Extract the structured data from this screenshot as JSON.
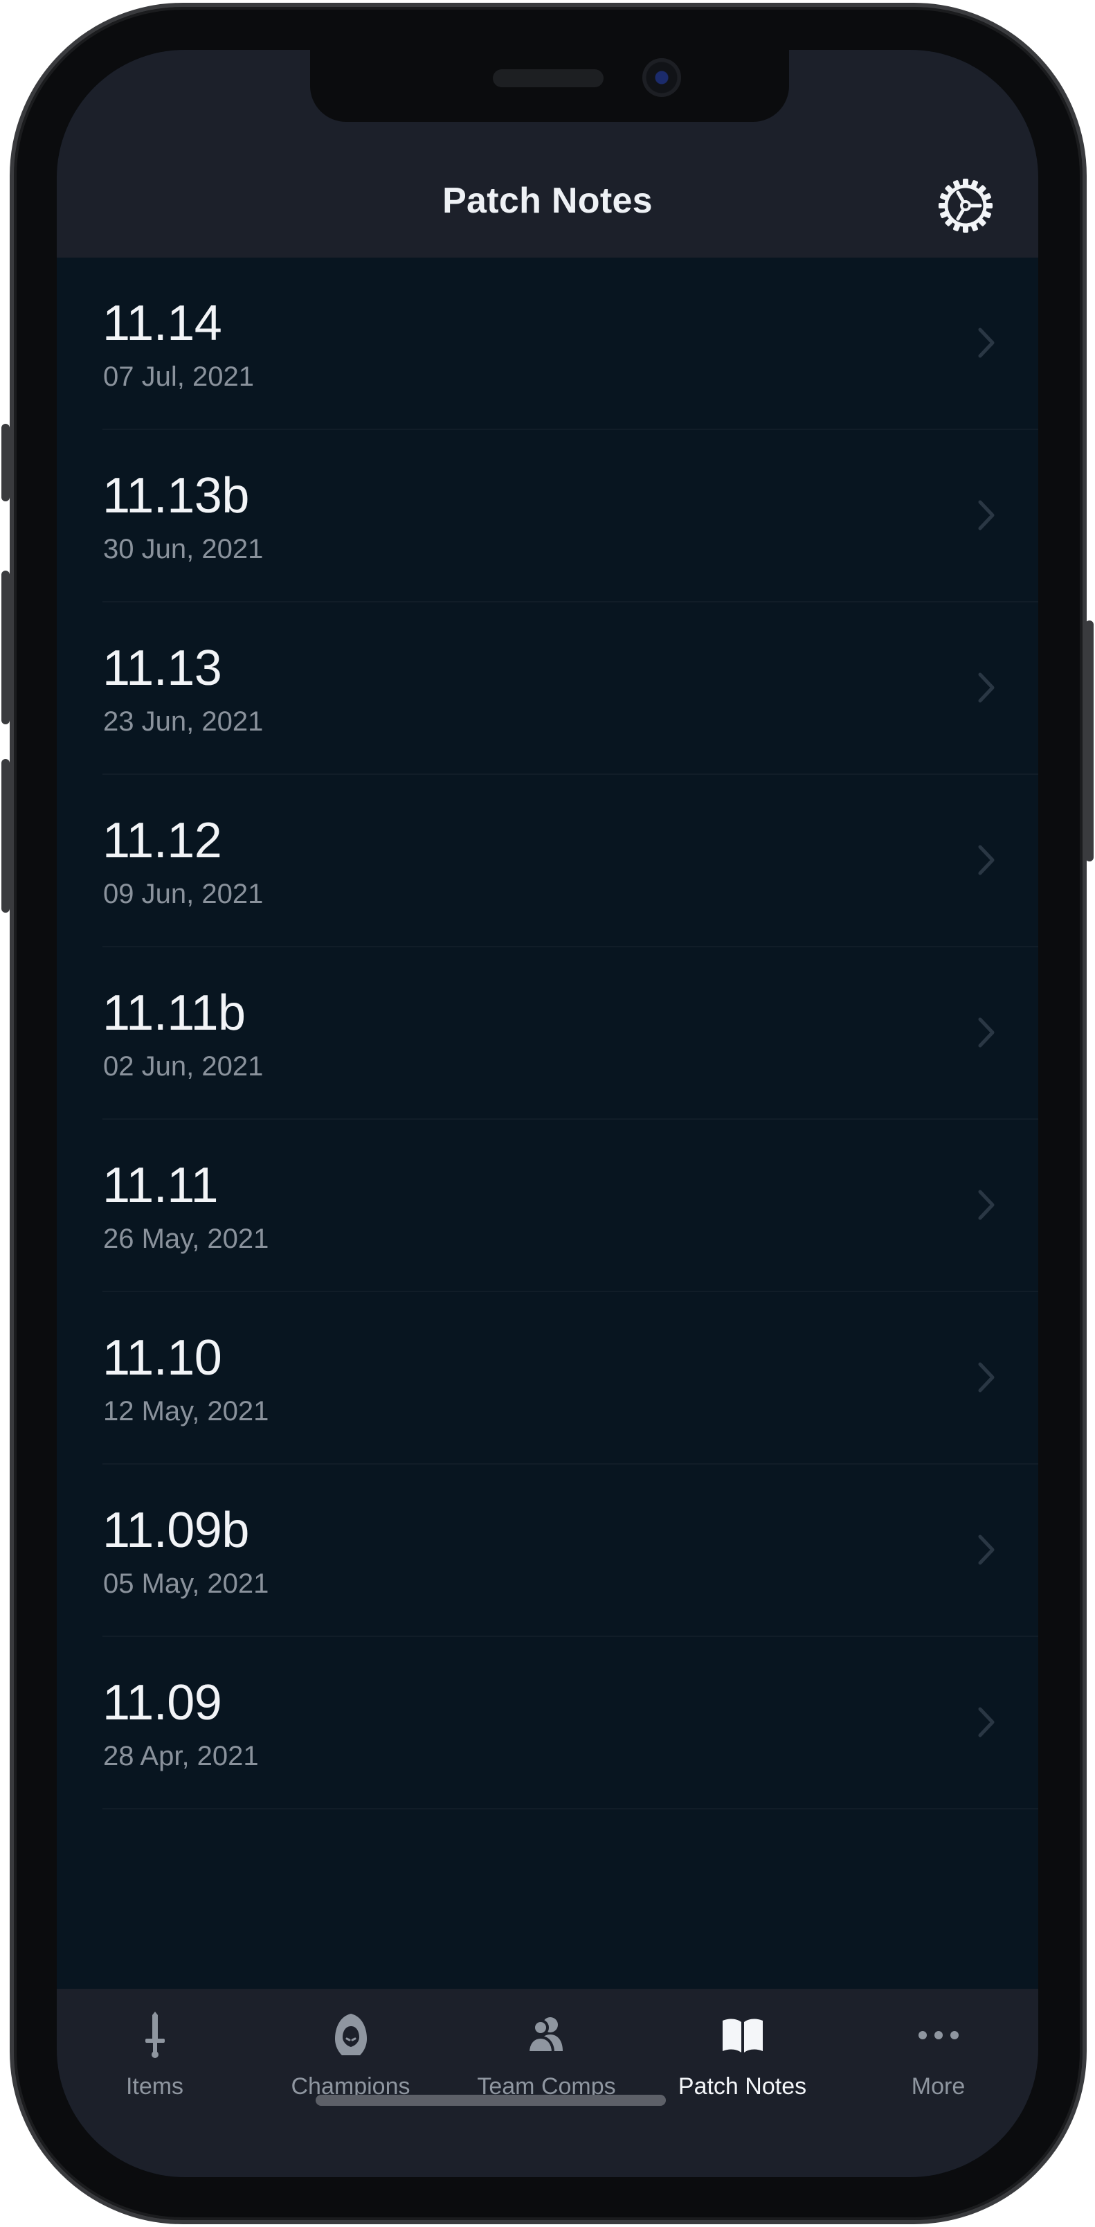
{
  "nav": {
    "title": "Patch Notes",
    "settings_icon": "gear-icon"
  },
  "patches": [
    {
      "version": "11.14",
      "date": "07 Jul, 2021"
    },
    {
      "version": "11.13b",
      "date": "30 Jun, 2021"
    },
    {
      "version": "11.13",
      "date": "23 Jun, 2021"
    },
    {
      "version": "11.12",
      "date": "09 Jun, 2021"
    },
    {
      "version": "11.11b",
      "date": "02 Jun, 2021"
    },
    {
      "version": "11.11",
      "date": "26 May, 2021"
    },
    {
      "version": "11.10",
      "date": "12 May, 2021"
    },
    {
      "version": "11.09b",
      "date": "05 May, 2021"
    },
    {
      "version": "11.09",
      "date": "28 Apr, 2021"
    }
  ],
  "tabs": [
    {
      "label": "Items",
      "icon": "sword-icon",
      "active": false
    },
    {
      "label": "Champions",
      "icon": "hooded-champion-icon",
      "active": false
    },
    {
      "label": "Team Comps",
      "icon": "team-icon",
      "active": false
    },
    {
      "label": "Patch Notes",
      "icon": "open-book-icon",
      "active": true
    },
    {
      "label": "More",
      "icon": "more-dots-icon",
      "active": false
    }
  ],
  "colors": {
    "background": "#081520",
    "bar": "#1c202a",
    "text_primary": "#f2f4f7",
    "text_secondary": "#8a929c",
    "tab_inactive": "#8f96a0",
    "tab_active": "#f4f6f9"
  }
}
